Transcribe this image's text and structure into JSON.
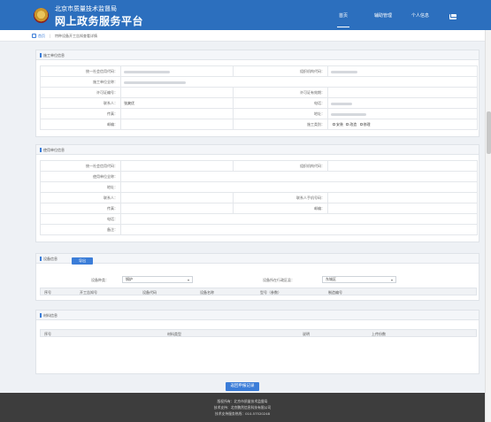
{
  "header": {
    "org_name": "北京市质量技术监督局",
    "platform_title": "网上政务服务平台",
    "nav": [
      {
        "label": "首页",
        "active": true
      },
      {
        "label": "辅助管理",
        "active": false
      },
      {
        "label": "个人信息",
        "active": false
      }
    ],
    "brand_color": "#2c6fbe"
  },
  "breadcrumb": {
    "home": "首页",
    "separator": "|",
    "current": "特种设备开工告知查看详情"
  },
  "construction_unit": {
    "title": "施工单位信息",
    "labels": {
      "credit_code": "统一社会信用代码：",
      "org_code": "组织机构代码：",
      "full_name": "施工单位全称：",
      "license_no": "许可证编号：",
      "license_valid": "许可证有效期：",
      "contact": "联系人：",
      "phone": "电话：",
      "fax": "传真：",
      "address": "地址：",
      "zip": "邮编：",
      "category": "施工类别："
    },
    "values": {
      "contact": "张爽优"
    },
    "category_options": [
      "安装",
      "改造",
      "修理"
    ]
  },
  "user_unit": {
    "title": "使用单位信息",
    "labels": {
      "credit_code": "统一社会信用代码：",
      "org_code": "组织机构代码：",
      "full_name": "使用单位全称：",
      "address": "地址：",
      "contact": "联系人：",
      "mobile": "联系人手机号码：",
      "fax": "传真：",
      "zip": "邮编：",
      "tel": "电话：",
      "remark": "备注："
    }
  },
  "equipment": {
    "title": "设备信息",
    "import_button": "导出",
    "type_label": "设备种类：",
    "type_value": "锅炉",
    "district_label": "设备所在行政区县：",
    "district_value": "东城区",
    "columns": [
      "序号",
      "开工告知号",
      "设备代码",
      "设备名称",
      "型号（参数）",
      "制造编号"
    ]
  },
  "materials": {
    "title": "材料信息",
    "columns": [
      "序号",
      "材料类型",
      "说明",
      "上传份数"
    ]
  },
  "submit_label": "返回申报记录",
  "footer": {
    "line1": "版权所有：北京市质量技术监督局",
    "line2": "技术支持：北京鹏然信息科技有限公司",
    "line3": "技术支持服务热线：010-57520248"
  }
}
